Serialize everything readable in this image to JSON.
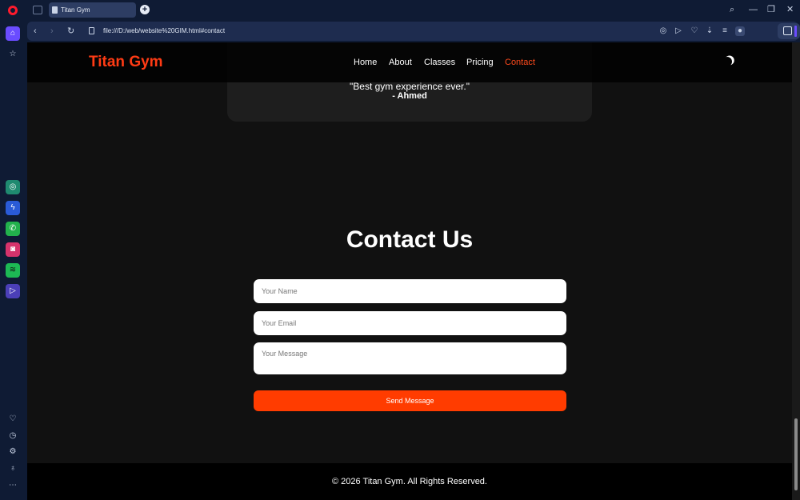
{
  "browser": {
    "tab_title": "Titan Gym",
    "url": "file:///D:/web/website%20GIM.html#contact",
    "ai_label": "AI",
    "new_tab": "+"
  },
  "site": {
    "brand": "Titan Gym",
    "nav": [
      {
        "label": "Home",
        "active": false
      },
      {
        "label": "About",
        "active": false
      },
      {
        "label": "Classes",
        "active": false
      },
      {
        "label": "Pricing",
        "active": false
      },
      {
        "label": "Contact",
        "active": true
      }
    ],
    "testimonial": {
      "quote": "\"Best gym experience ever.\"",
      "author": "- Ahmed"
    },
    "contact": {
      "title": "Contact Us",
      "name_placeholder": "Your Name",
      "email_placeholder": "Your Email",
      "message_placeholder": "Your Message",
      "send_label": "Send Message"
    },
    "footer": "© 2026 Titan Gym. All Rights Reserved."
  },
  "colors": {
    "accent": "#ff3c00",
    "brand": "#ff3b14",
    "page_bg": "#111111",
    "chrome_bg": "#0f1b34"
  },
  "icons": [
    "opera-logo-icon",
    "home-icon",
    "star-icon",
    "chatgpt-icon",
    "messenger-icon",
    "whatsapp-icon",
    "instagram-icon",
    "spotify-icon",
    "player-icon",
    "heart-icon",
    "history-icon",
    "settings-icon",
    "lightbulb-icon",
    "more-icon",
    "moon-icon"
  ]
}
